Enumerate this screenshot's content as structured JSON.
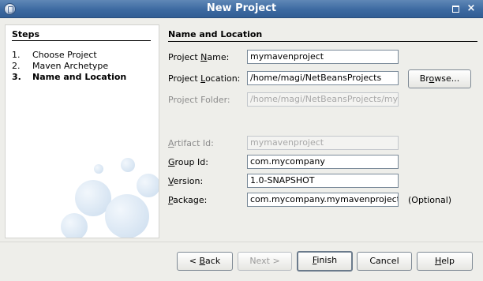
{
  "window": {
    "title": "New Project"
  },
  "steps": {
    "title": "Steps",
    "items": [
      {
        "num": "1.",
        "label": "Choose Project",
        "active": false
      },
      {
        "num": "2.",
        "label": "Maven Archetype",
        "active": false
      },
      {
        "num": "3.",
        "label": "Name and Location",
        "active": true
      }
    ]
  },
  "form": {
    "section_title": "Name and Location",
    "project_name": {
      "label_pre": "Project ",
      "label_key": "N",
      "label_post": "ame:",
      "value": "mymavenproject"
    },
    "project_location": {
      "label_pre": "Project ",
      "label_key": "L",
      "label_post": "ocation:",
      "value": "/home/magi/NetBeansProjects"
    },
    "browse_label_pre": "Br",
    "browse_key": "o",
    "browse_label_post": "wse...",
    "project_folder": {
      "label": "Project Folder:",
      "value": "/home/magi/NetBeansProjects/my"
    },
    "artifact_id": {
      "label_pre": "",
      "label_key": "A",
      "label_post": "rtifact Id:",
      "value": "mymavenproject"
    },
    "group_id": {
      "label_pre": "",
      "label_key": "G",
      "label_post": "roup Id:",
      "value": "com.mycompany"
    },
    "version": {
      "label_pre": "",
      "label_key": "V",
      "label_post": "ersion:",
      "value": "1.0-SNAPSHOT"
    },
    "package": {
      "label_pre": "",
      "label_key": "P",
      "label_post": "ackage:",
      "value": "com.mycompany.mymavenproject",
      "note": "(Optional)"
    }
  },
  "buttons": {
    "back": {
      "pre": "< ",
      "key": "B",
      "post": "ack"
    },
    "next": {
      "label": "Next >"
    },
    "finish": {
      "pre": "",
      "key": "F",
      "post": "inish"
    },
    "cancel": {
      "label": "Cancel"
    },
    "help": {
      "pre": "",
      "key": "H",
      "post": "elp"
    }
  }
}
